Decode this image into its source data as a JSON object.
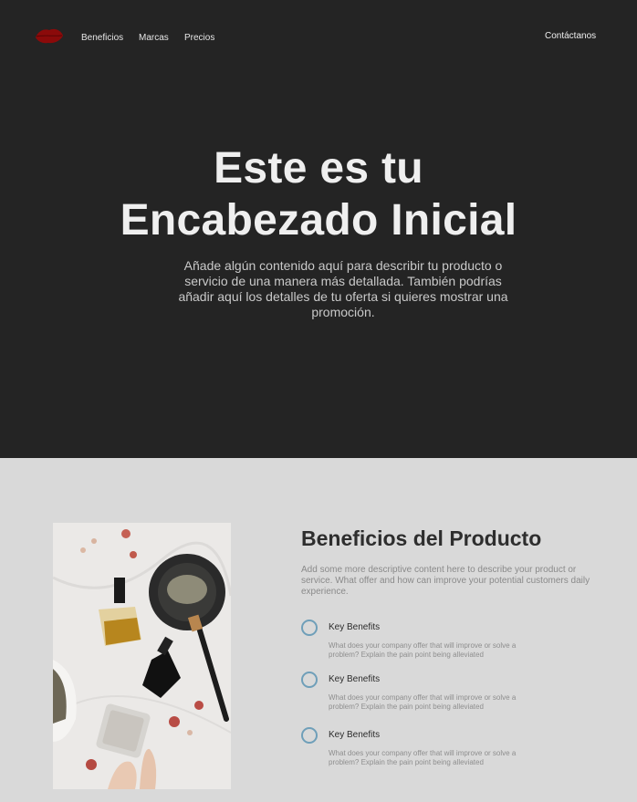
{
  "nav": {
    "items": [
      {
        "label": "Beneficios"
      },
      {
        "label": "Marcas"
      },
      {
        "label": "Precios"
      }
    ],
    "contact_label": "Contáctanos"
  },
  "hero": {
    "title_line1": "Este es tu",
    "title_line2": "Encabezado Inicial",
    "subtitle": "Añade algún contenido aquí para describir tu producto o servicio de una manera más detallada. También podrías añadir aquí los detalles de tu oferta si quieres mostrar una promoción."
  },
  "benefits": {
    "title": "Beneficios del Producto",
    "description": "Add some more descriptive content here to describe your product or service. What offer and how can improve your potential customers daily experience.",
    "items": [
      {
        "title": "Key Benefits",
        "description": "What does your company offer that will improve or solve a problem? Explain the pain point being alleviated"
      },
      {
        "title": "Key Benefits",
        "description": "What does your company offer that will improve or solve a problem? Explain the pain point being alleviated"
      },
      {
        "title": "Key Benefits",
        "description": "What does your company offer that will improve or solve a problem? Explain the pain point being alleviated"
      }
    ]
  },
  "colors": {
    "hero_bg": "#242424",
    "section_bg": "#d9d9d9",
    "logo": "#8b0a0a",
    "accent_circle": "#6f9fb9"
  },
  "icons": {
    "logo": "red-lips-logo",
    "benefit": "circle-outline-icon"
  }
}
